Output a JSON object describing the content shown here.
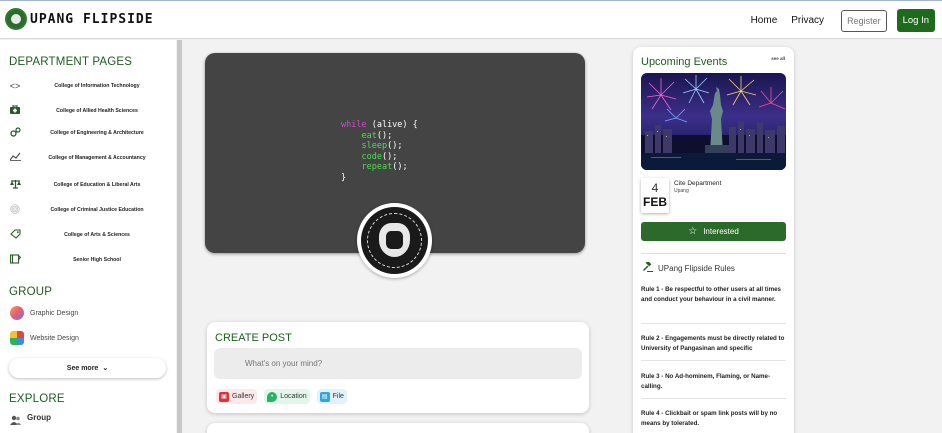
{
  "app": {
    "brand": "UPANG FLIPSIDE"
  },
  "nav": {
    "home": "Home",
    "privacy": "Privacy",
    "register": "Register",
    "login": "Log In"
  },
  "sidebar": {
    "departments_title": "DEPARTMENT PAGES",
    "departments": [
      {
        "label": "College of Information Technology",
        "icon": "code-icon"
      },
      {
        "label": "College of Allied Health Sciences",
        "icon": "medkit-icon"
      },
      {
        "label": "College of Engineering & Architecture",
        "icon": "gears-icon"
      },
      {
        "label": "College of Management & Accountancy",
        "icon": "chart-line-icon"
      },
      {
        "label": "College of Education & Liberal Arts",
        "icon": "scale-icon"
      },
      {
        "label": "College of Criminal Justice Education",
        "icon": "fingerprint-icon"
      },
      {
        "label": "College of Arts & Sciences",
        "icon": "tag-heart-icon"
      },
      {
        "label": "Senior High School",
        "icon": "book-icon"
      }
    ],
    "group_title": "GROUP",
    "groups": [
      {
        "label": "Graphic Design",
        "icon": "graphic-design-avatar"
      },
      {
        "label": "Website Design",
        "icon": "website-design-avatar"
      }
    ],
    "see_more": "See more",
    "explore_title": "EXPLORE",
    "explore": [
      {
        "label": "Group",
        "icon": "users-icon"
      }
    ]
  },
  "cover": {
    "code_lines": [
      {
        "kw": "while",
        "rest": " (alive) {"
      },
      {
        "fn": "eat",
        "rest": "();"
      },
      {
        "fn": "sleep",
        "rest": "();"
      },
      {
        "fn": "code",
        "rest": "();"
      },
      {
        "fn": "repeat",
        "rest": "();"
      },
      {
        "rest": "}"
      }
    ]
  },
  "create_post": {
    "title": "CREATE POST",
    "placeholder": "What's on your mind?",
    "actions": [
      {
        "label": "Gallery",
        "color": "#e0303a"
      },
      {
        "label": "Location",
        "color": "#28b463"
      },
      {
        "label": "File",
        "color": "#2ea6e0"
      }
    ]
  },
  "events": {
    "title": "Upcoming Events",
    "see_all": "see all",
    "event": {
      "day": "4",
      "month": "FEB",
      "department": "Cite Department",
      "campus": "Upang"
    },
    "interested": "Interested"
  },
  "rules": {
    "title": "UPang Flipside Rules",
    "items": [
      {
        "label": "Rule 1",
        "text": " - Be respectful to other users at all times and conduct your behaviour in a civil manner."
      },
      {
        "label": "Rule 2",
        "text": " - Engagements must be directly related to University of Pangasinan and specific"
      },
      {
        "label": "Rule 3",
        "text": " - No Ad-hominem, Flaming, or Name-calling."
      },
      {
        "label": "Rule 4",
        "text": " - Clickbait or spam link posts will by no means by tolerated."
      }
    ]
  },
  "colors": {
    "brand_green": "#1e6b1e",
    "heading_green": "#1e5d1e",
    "cover_bg": "#444444"
  }
}
